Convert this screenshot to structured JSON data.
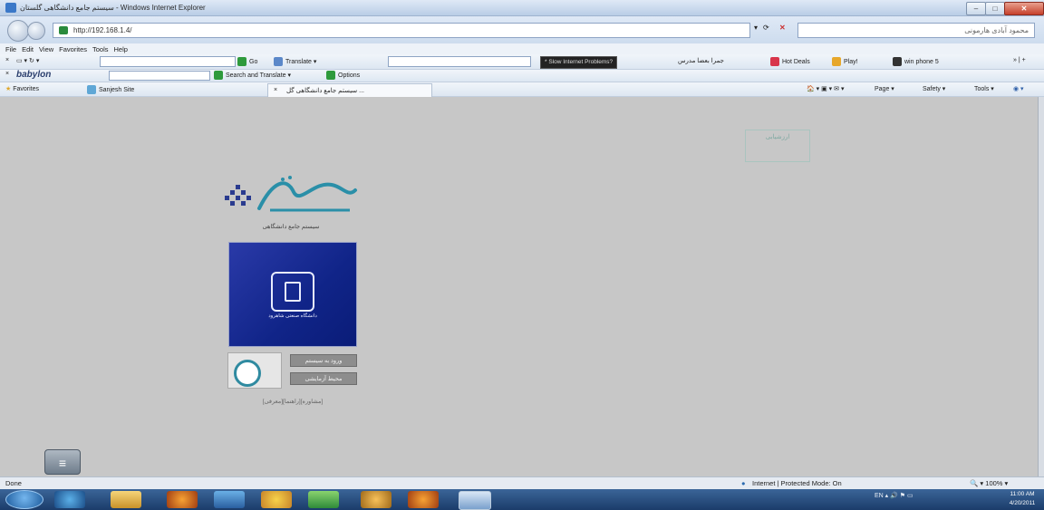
{
  "window": {
    "title": "سیستم جامع دانشگاهی گلستان - Windows Internet Explorer"
  },
  "address_bar": {
    "url": "http://192.168.1.4/",
    "search_placeholder": "محمود آبادی هارمونی"
  },
  "menu": [
    "File",
    "Edit",
    "View",
    "Favorites",
    "Tools",
    "Help"
  ],
  "toolbar1": {
    "go_label": "Go",
    "translate_label": "Translate",
    "slow_problems_label": "* Slow Internet Problems?",
    "rtl_text": "جمرا بعضا مدرس",
    "hot_deals": "Hot Deals",
    "play": "Play!",
    "win_phone": "win phone 5"
  },
  "toolbar2": {
    "brand": "babylon",
    "search_translate": "Search and Translate",
    "options": "Options"
  },
  "favorites_row": {
    "favorites": "Favorites",
    "sanjesh_site": "Sanjesh Site",
    "tab_title": "سیستم جامع دانشگاهی گل ...",
    "page_menu": "Page",
    "safety_menu": "Safety",
    "tools_menu": "Tools"
  },
  "content": {
    "logo_caption": "سیستم جامع دانشگاهی",
    "university_caption": "دانشگاه صنعتی شاهرود",
    "login_button": "ورود به سیستم",
    "test_env_button": "محیط آزمایشی",
    "footer_links": "[معرفی][راهنما][مشاوره]",
    "stamp_text": "ارزشیابی"
  },
  "statusbar": {
    "left": "Done",
    "zone": "Internet | Protected Mode: On",
    "zoom": "100%"
  },
  "taskbar": {
    "lang": "EN",
    "time": "11:00 AM",
    "date": "4/20/2011"
  },
  "colors": {
    "panel_blue": "#102488",
    "button_grey": "#8d8d8d",
    "background": "#c7c7c7"
  }
}
